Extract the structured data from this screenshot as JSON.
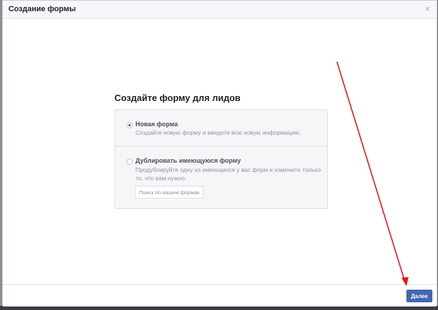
{
  "dialog": {
    "title": "Создание формы",
    "close_glyph": "×"
  },
  "content": {
    "title": "Создайте форму для лидов",
    "options": [
      {
        "title": "Новая форма",
        "description": "Создайте новую форму и введите всю новую информацию.",
        "selected": true
      },
      {
        "title": "Дублировать имеющуюся форму",
        "description": "Продублируйте одну из имеющихся у вас форм и измените только то, что вам нужно.",
        "selected": false
      }
    ],
    "search": {
      "placeholder": "Поиск по вашим формам",
      "value": ""
    }
  },
  "footer": {
    "next_label": "Далее"
  },
  "colors": {
    "primary_button": "#4267b2",
    "annotation_arrow": "#e8161b"
  }
}
